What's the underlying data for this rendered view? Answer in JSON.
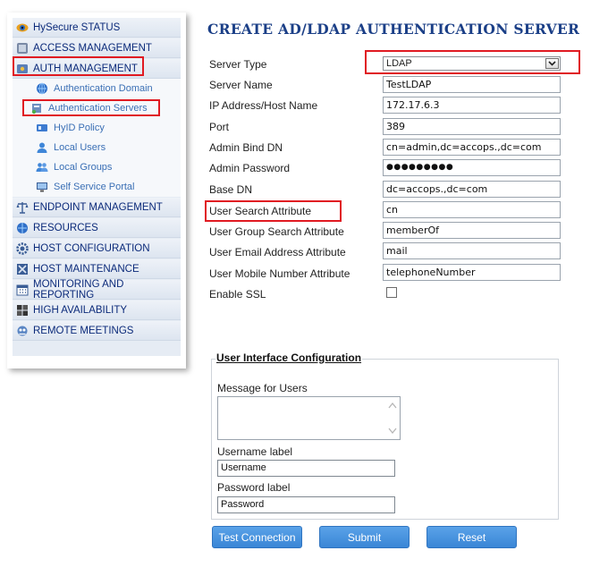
{
  "sidebar": {
    "items": [
      {
        "label": "HySecure STATUS",
        "icon": "eye-icon"
      },
      {
        "label": "ACCESS MANAGEMENT",
        "icon": "gears-icon"
      },
      {
        "label": "AUTH MANAGEMENT",
        "icon": "key-icon"
      },
      {
        "label": "Authentication Domain",
        "icon": "globe-icon"
      },
      {
        "label": "Authentication Servers",
        "icon": "server-icon"
      },
      {
        "label": "HyID Policy",
        "icon": "id-card-icon"
      },
      {
        "label": "Local Users",
        "icon": "user-icon"
      },
      {
        "label": "Local Groups",
        "icon": "group-icon"
      },
      {
        "label": "Self Service Portal",
        "icon": "monitor-icon"
      },
      {
        "label": "ENDPOINT MANAGEMENT",
        "icon": "scales-icon"
      },
      {
        "label": "RESOURCES",
        "icon": "globe-icon"
      },
      {
        "label": "HOST CONFIGURATION",
        "icon": "gear-icon"
      },
      {
        "label": "HOST MAINTENANCE",
        "icon": "tools-icon"
      },
      {
        "label": "MONITORING AND REPORTING",
        "icon": "calendar-icon"
      },
      {
        "label": "HIGH AVAILABILITY",
        "icon": "grid-icon"
      },
      {
        "label": "REMOTE MEETINGS",
        "icon": "meeting-icon"
      }
    ]
  },
  "page": {
    "title": "CREATE AD/LDAP AUTHENTICATION SERVER"
  },
  "form": {
    "server_type": {
      "label": "Server Type",
      "value": "LDAP"
    },
    "server_name": {
      "label": "Server Name",
      "value": "TestLDAP"
    },
    "ip_address": {
      "label": "IP Address/Host Name",
      "value": "172.17.6.3"
    },
    "port": {
      "label": "Port",
      "value": "389"
    },
    "admin_bind_dn": {
      "label": "Admin Bind DN",
      "value": "cn=admin,dc=accops.,dc=com"
    },
    "admin_password": {
      "label": "Admin Password",
      "value": "●●●●●●●●●"
    },
    "base_dn": {
      "label": "Base DN",
      "value": "dc=accops.,dc=com"
    },
    "user_search_attr": {
      "label": "User Search Attribute",
      "value": "cn"
    },
    "user_group_search_attr": {
      "label": "User Group Search Attribute",
      "value": "memberOf"
    },
    "user_email_attr": {
      "label": "User Email Address Attribute",
      "value": "mail"
    },
    "user_mobile_attr": {
      "label": "User Mobile Number Attribute",
      "value": "telephoneNumber"
    },
    "enable_ssl": {
      "label": "Enable SSL",
      "checked": false
    }
  },
  "ui_config": {
    "legend": "User Interface Configuration",
    "message_label": "Message for Users",
    "message_value": "",
    "username_label": "Username label",
    "username_value": "Username",
    "password_label": "Password label",
    "password_value": "Password"
  },
  "buttons": {
    "test": "Test Connection",
    "submit": "Submit",
    "reset": "Reset"
  },
  "colors": {
    "highlight": "#e01a22",
    "button": "#3a86d6",
    "title": "#1b3f87"
  }
}
